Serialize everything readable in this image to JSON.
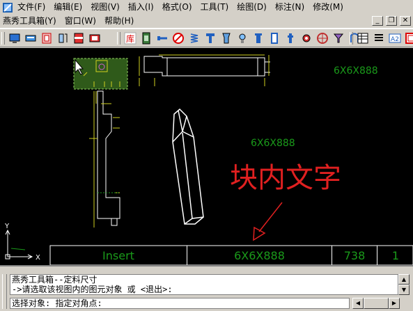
{
  "menubar": {
    "items": [
      "文件(F)",
      "编辑(E)",
      "视图(V)",
      "插入(I)",
      "格式(O)",
      "工具(T)",
      "绘图(D)",
      "标注(N)",
      "修改(M)"
    ]
  },
  "menubar2": {
    "items": [
      "燕秀工具箱(Y)",
      "窗口(W)",
      "帮助(H)"
    ]
  },
  "window_buttons": {
    "minimize": "_",
    "restore": "❐",
    "close": "✕"
  },
  "toolbar": {
    "library_label": "库",
    "a2_label": "A2"
  },
  "canvas": {
    "label_top_right": "6X6X888",
    "label_center": "6X6X888",
    "block_text": "块内文字",
    "ucs_y": "Y",
    "ucs_x": "X"
  },
  "status_table": {
    "col1": "Insert",
    "col2": "6X6X888",
    "col3": "738",
    "col4": "1"
  },
  "command": {
    "line1": "燕秀工具箱--定料尺寸",
    "line2": "->请选取该视图内的图元对象 或 <退出>:",
    "input": "选择对象: 指定对角点:"
  },
  "colors": {
    "canvas_bg": "#000000",
    "drawing_green": "#1a9a1a",
    "annotation_red": "#e02020",
    "chrome": "#d4d0c8"
  }
}
